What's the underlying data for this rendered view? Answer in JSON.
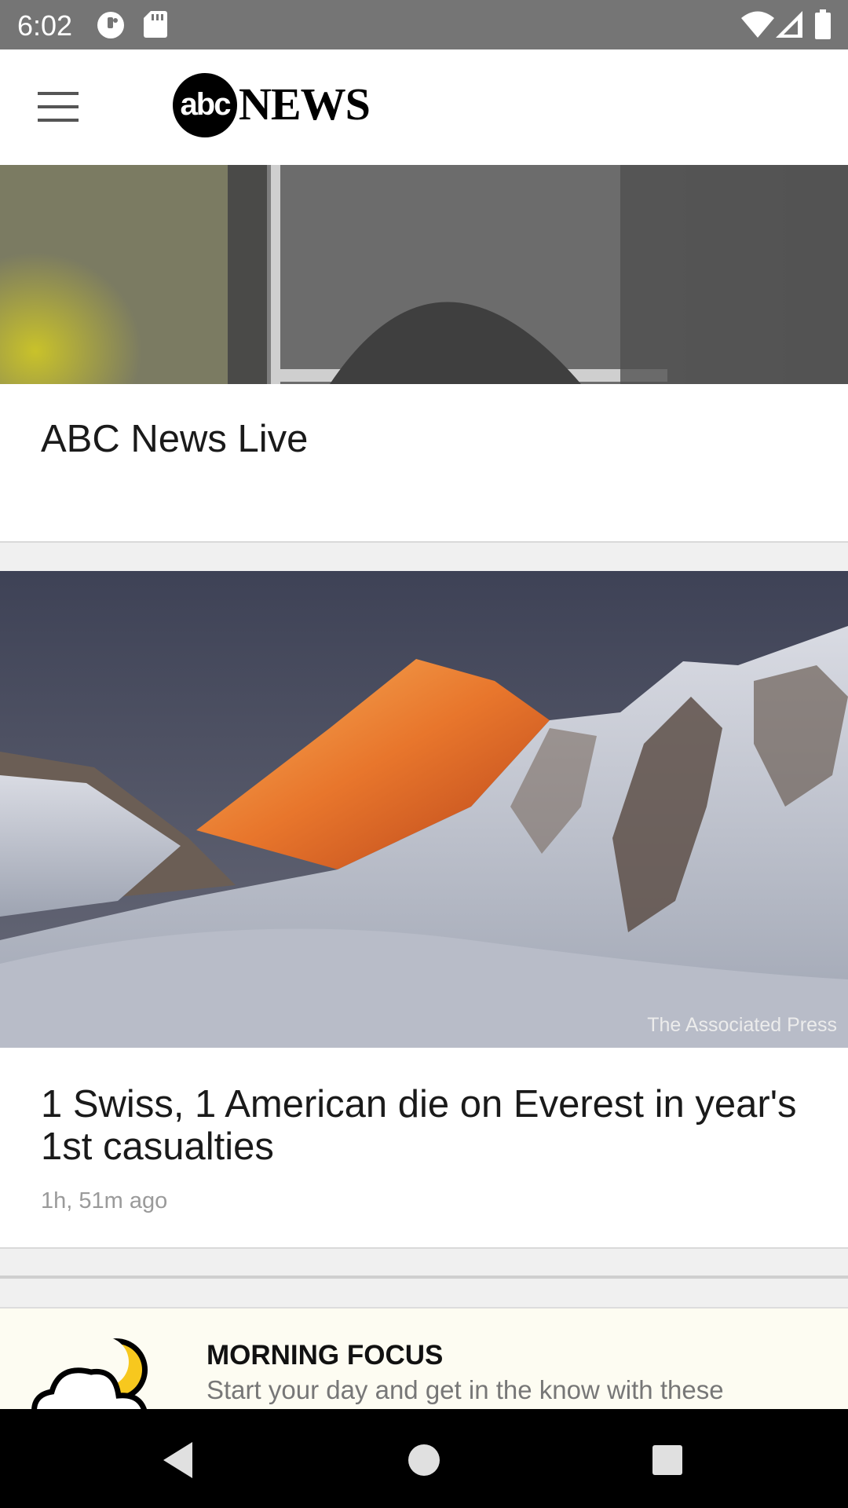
{
  "status_bar": {
    "time": "6:02",
    "left_icons": [
      "data-saver-icon",
      "sd-card-icon"
    ],
    "right_icons": [
      "wifi-icon",
      "cell-signal-icon",
      "battery-icon"
    ]
  },
  "header": {
    "logo_mark": "abc",
    "logo_word": "NEWS",
    "menu_icon": "hamburger-menu-icon"
  },
  "cards": [
    {
      "title": "ABC News Live"
    },
    {
      "title": "1 Swiss, 1 American die on Everest in year's 1st casualties",
      "image_credit": "The Associated Press",
      "time_ago": "1h, 51m ago"
    }
  ],
  "morning_focus": {
    "title": "MORNING FOCUS",
    "subtitle": "Start your day and get in the know with these",
    "icon": "moon-cloud-icon"
  },
  "nav_bar": {
    "icons": [
      "back-icon",
      "home-icon",
      "recents-icon"
    ]
  },
  "colors": {
    "status_bar": "#757575",
    "header_bg": "#ffffff",
    "feed_bg": "#f0f0f0",
    "moon": "#f7c81e",
    "focus_bg": "#fdfcf2"
  }
}
